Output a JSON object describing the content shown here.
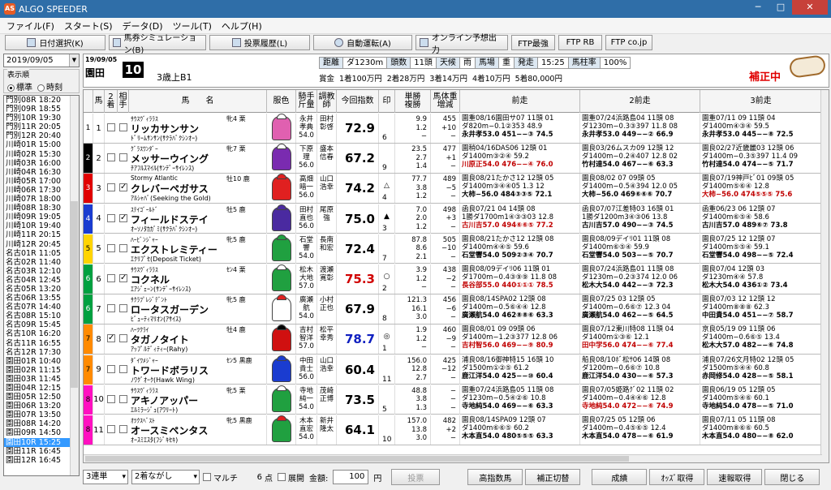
{
  "window": {
    "title": "ALGO SPEEDER",
    "icon_text": "AS"
  },
  "menu": [
    "ファイル(F)",
    "スタート(S)",
    "データ(D)",
    "ツール(T)",
    "ヘルプ(H)"
  ],
  "toolbar": [
    "日付選択(K)",
    "馬券シミュレーション(B)",
    "投票履歴(L)",
    "自動運転(A)",
    "オンライン予想出力",
    "FTP最強",
    "FTP RB",
    "FTP co.jp"
  ],
  "left": {
    "date": "2019/09/05",
    "sort_label": "表示順",
    "sort_opt1": "標準",
    "sort_opt2": "時刻",
    "races": [
      "門別08R 18:20",
      "門別09R 18:55",
      "門別10R 19:30",
      "門別11R 20:05",
      "門別12R 20:40",
      "川崎01R 15:00",
      "川崎02R 15:30",
      "川崎03R 16:00",
      "川崎04R 16:30",
      "川崎05R 17:00",
      "川崎06R 17:30",
      "川崎07R 18:00",
      "川崎08R 18:30",
      "川崎09R 19:05",
      "川崎10R 19:40",
      "川崎11R 20:15",
      "川崎12R 20:45",
      "名古01R 11:05",
      "名古02R 11:40",
      "名古03R 12:10",
      "名古04R 12:45",
      "名古05R 13:20",
      "名古06R 13:55",
      "名古07R 14:40",
      "名古08R 15:10",
      "名古09R 15:45",
      "名古10R 16:20",
      "名古11R 16:55",
      "名古12R 17:30",
      "園田01R 10:40",
      "園田02R 11:15",
      "園田03R 11:45",
      "園田04R 12:15",
      "園田05R 12:50",
      "園田06R 13:20",
      "園田07R 13:50",
      "園田08R 14:20",
      "園田09R 14:50",
      "園田10R 15:25",
      "園田11R 16:45",
      "園田12R 16:45"
    ],
    "selected_index": 38
  },
  "race": {
    "date": "19/09/05",
    "track": "園田",
    "number": "10",
    "class": "3歳上B1",
    "info": [
      {
        "k": "距離",
        "v": "ダ1230m"
      },
      {
        "k": "頭数",
        "v": "11頭"
      },
      {
        "k": "天候",
        "v": "雨"
      },
      {
        "k": "馬場",
        "v": "重"
      },
      {
        "k": "発走",
        "v": "15:25"
      },
      {
        "k": "馬柱率",
        "v": "100%"
      }
    ],
    "prize": "賞金 1着100万円 2着28万円 3着14万円 4着10万円 5着80,000円",
    "status": "補正中"
  },
  "columns": [
    "馬",
    "2着",
    "相手",
    "馬　　名",
    "服色",
    "騎手\n斤量",
    "調教\n師",
    "今回指数",
    "印",
    "単勝\n複勝",
    "馬体重\n増減",
    "前走",
    "2前走",
    "3前走"
  ],
  "horses": [
    {
      "waku": "1",
      "wakuColor": "#ffffff",
      "no": "1",
      "c2": false,
      "c3": false,
      "sire": "ｻｳｽｳﾞｨﾗﾗｽ",
      "sex": "牝4 栗",
      "name": "リッカサンサン",
      "dam": "ﾄﾞﾘｰﾑｻﾝｻﾝ(ｻｸﾗﾊﾞｸｼﾝｵｰ)",
      "silk": "#e060b0",
      "cap": "#ffffff",
      "jockey": "永井\n孝典\n54.0",
      "trainer": "田村\n彰啓",
      "index": "72.9",
      "idxColor": "",
      "mark": "",
      "pop": "6",
      "odds": "9.9\n1.2\n−",
      "weight": "455\n+10\n−",
      "p1": [
        "園重08/16園田サ07 11頭 01",
        "ダ820m−0.1②353 48.9",
        "永井孝53.0 451−−③ 74.5"
      ],
      "p1red": false,
      "p2": [
        "園重07/24浜路島04 11頭 08",
        "ダ1230m−0.3③397 11.8 08",
        "永井孝53.0 449−−② 66.9"
      ],
      "p2red": false,
      "p3": [
        "園重07/11 09 11頭 04",
        "ダ1400m④③④ 59.5",
        "永井孝53.0 445−−⑧ 72.5"
      ],
      "p3red": false
    },
    {
      "waku": "2",
      "wakuColor": "#000000",
      "no": "2",
      "c2": false,
      "c3": false,
      "sire": "ｸﾞﾗｽﾜﾝﾀﾞｰ",
      "sex": "牝7 栗",
      "name": "メッサーウイング",
      "dam": "ﾁｱﾌﾙｽﾏｲﾙ(ｻﾝﾃﾞｰｻｲﾚﾝｽ)",
      "silk": "#7a2bb0",
      "cap": "#ffffff",
      "jockey": "下原\n理\n56.0",
      "trainer": "盛本\n信春",
      "index": "67.2",
      "idxColor": "",
      "mark": "",
      "pop": "9",
      "odds": "23.5\n2.7\n1.4",
      "weight": "477\n+1\n−",
      "p1": [
        "園稍04/16DAS06 12頭 01",
        "ダ1400m③②④ 59.2",
        "川原正54.0 476−−④ 76.0"
      ],
      "p1red": true,
      "p2": [
        "園良03/26ムスカ09 12頭 12",
        "ダ1400m−0.2④407 12.8 02",
        "竹村達54.0 467−−⑥ 63.3"
      ],
      "p2red": false,
      "p3": [
        "園良02/27近畿麗03 12頭 06",
        "ダ1400m−0.3⑤397 11.4 09",
        "竹村達54.0 474−−⑤ 71.7"
      ],
      "p3red": false
    },
    {
      "waku": "3",
      "wakuColor": "#e00000",
      "no": "3",
      "c2": false,
      "c3": true,
      "sire": "Stormy Atlantic",
      "sex": "牡10 鹿",
      "name": "クレバーペガサス",
      "dam": "ｱﾙｼｬﾊﾞ(Seeking the Gold)",
      "silk": "#e02020",
      "cap": "#e02020",
      "jockey": "高畑\n暗一\n56.0",
      "trainer": "山口\n浩幸",
      "index": "74.2",
      "idxColor": "",
      "mark": "△",
      "pop": "4",
      "odds": "77.7\n3.8\n1.2",
      "weight": "489\n−5\n−",
      "p1": [
        "園良08/21たかさ12 12頭 05",
        "ダ1400m③④④05 1.3 12",
        "大柿−56.0 484③③⑤ 72.1"
      ],
      "p1red": false,
      "p2": [
        "園良08/02 07 09頭 05",
        "ダ1400m−0.5④394 12.0 05",
        "大柿−56.0 469⑥⑥⑥ 70.7"
      ],
      "p2red": false,
      "p3": [
        "園良07/19神戸ﾋﾞ01 09頭 05",
        "ダ1400m⑤⑥④ 12.8",
        "大柿−56.0 474⑤⑤⑤ 75.6"
      ],
      "p3red": true
    },
    {
      "waku": "4",
      "wakuColor": "#1a3cd0",
      "no": "4",
      "c2": false,
      "c3": true,
      "sire": "ｽﾃｲｺﾞｰﾙﾄﾞ",
      "sex": "牡5 鹿",
      "name": "フィールドステイ",
      "dam": "ｵｰｿﾉﾀｶｶﾞﾐ(ｻｸﾗﾊﾞｸｼﾝｵｰ)",
      "silk": "#4a2aa0",
      "cap": "#4a2aa0",
      "jockey": "田村\n直也\n56.0",
      "trainer": "尾原\n強",
      "index": "75.0",
      "idxColor": "",
      "mark": "▲",
      "pop": "3",
      "odds": "7.0\n2.0\n1.2",
      "weight": "498\n+3\n−",
      "p1": [
        "函良07/21 04 14頭 08",
        "1勝ダ1700m1④③③03 12.8",
        "古川吉57.0 494⑥⑥⑤ 77.2"
      ],
      "p1red": true,
      "p2": [
        "函良07/07江差特03 16頭 01",
        "1勝ダ1200m3④③06 13.8",
        "古川吉57.0 490−−③ 74.5"
      ],
      "p2red": false,
      "p3": [
        "函重06/23 06 12頭 07",
        "ダ1400m⑥⑤④ 58.6",
        "古川吉57.0 489⑥⑦ 73.8"
      ],
      "p3red": false
    },
    {
      "waku": "5",
      "wakuColor": "#ffd400",
      "no": "5",
      "c2": false,
      "c3": false,
      "sire": "ﾊｰﾋﾞﾝｼﾞｬｰ",
      "sex": "牝5 鹿",
      "name": "エクストレミティー",
      "dam": "ｴｸﾘﾌﾟｾ(Deposit Ticket)",
      "silk": "#20a040",
      "cap": "#20a040",
      "jockey": "石堂\n響\n54.0",
      "trainer": "長南\n和宏",
      "index": "72.4",
      "idxColor": "",
      "mark": "",
      "pop": "7",
      "odds": "87.8\n8.6\n2.1",
      "weight": "505\n−10\n−",
      "p1": [
        "園良08/21たかさ12 12頭 08",
        "ダ1400m④④⑤ 59.6",
        "石堂響54.0 509②③④ 70.7"
      ],
      "p1red": false,
      "p2": [
        "園良08/09デイﾘ01 11頭 08",
        "ダ1400m⑥⑤④ 59.9",
        "石堂響54.0 503−−⑤ 70.7"
      ],
      "p2red": false,
      "p3": [
        "園良07/25 12 12頭 07",
        "ダ1400m⑤⑤④ 59.1",
        "石堂響54.0 498−−⑤ 72.4"
      ],
      "p3red": false
    },
    {
      "waku": "6",
      "wakuColor": "#00a040",
      "no": "6",
      "c2": false,
      "c3": true,
      "sire": "ｻｳｽｳﾞｨﾗﾗｽ",
      "sex": "ｾﾝ4 栗",
      "name": "コクネル",
      "dam": "ｴｱｼﾞｪｰﾝ(ｻﾝﾃﾞｰｻｲﾚﾝｽ)",
      "silk": "#20a040",
      "cap": "#ffffff",
      "jockey": "松木\n大地\n57.0",
      "trainer": "渡瀬\n寛彰",
      "index": "75.3",
      "idxColor": "red",
      "mark": "○",
      "pop": "2",
      "odds": "3.9\n1.2\n−",
      "weight": "438\n−2\n−",
      "p1": [
        "園良08/09デイﾘ06 11頭 01",
        "ダ1700m−0.4③⑨⑨ 11.8 08",
        "長谷部55.0 440①①① 78.5"
      ],
      "p1red": true,
      "p2": [
        "園良07/24浜路島01 11頭 08",
        "ダ1230m−0.2③374 12.0 06",
        "松木大54.0 442−−③ 72.3"
      ],
      "p2red": false,
      "p3": [
        "園良07/04 12頭 03",
        "ダ1230m④④ 57.8",
        "松木大54.0 436①② 73.4"
      ],
      "p3red": false
    },
    {
      "waku": "6",
      "wakuColor": "#00a040",
      "no": "7",
      "c2": false,
      "c3": false,
      "sire": "ｻｸﾗﾌﾟﾚｼﾞﾃﾞﾝﾄ",
      "sex": "牝5 鹿",
      "name": "ロータスガーデン",
      "dam": "ﾋﾞｭｰﾃｨﾏﾘｵﾝ(ｱｻｲｽ)",
      "silk": "#ffffff",
      "cap": "#e02020",
      "jockey": "廣瀬\n航\n54.0",
      "trainer": "小村\n正也",
      "index": "67.9",
      "idxColor": "",
      "mark": "",
      "pop": "8",
      "odds": "121.3\n16.1\n3.0",
      "weight": "456\n−6\n−",
      "p1": [
        "園良08/14SPA02 12頭 08",
        "ダ1400m−0.5⑥④④ 12.8",
        "廣瀬航54.0 462⑧⑧⑥ 63.3"
      ],
      "p1red": false,
      "p2": [
        "園良07/25 03 12頭 05",
        "ダ1400m−0.6⑥⑦ 12.3 04",
        "廣瀬航54.0 462−−⑤ 64.5"
      ],
      "p2red": false,
      "p3": [
        "園良07/03 12 12頭 12",
        "ダ1400m⑧⑧⑧ 62.3",
        "中田貴54.0 451−−⑦ 58.7"
      ],
      "p3red": false
    },
    {
      "waku": "7",
      "wakuColor": "#ff8a00",
      "no": "8",
      "c2": true,
      "c3": false,
      "sire": "ﾊｰﾂｸﾗｲ",
      "sex": "牡4 鹿",
      "name": "タガノタイト",
      "dam": "ｱｯﾌﾟﾙﾃﾞｨﾃｨｰ(Rahy)",
      "silk": "#d01010",
      "cap": "#000000",
      "jockey": "吉村\n智洋\n57.0",
      "trainer": "松平\n幸秀",
      "index": "78.7",
      "idxColor": "blue",
      "mark": "◎",
      "pop": "1",
      "odds": "1.9\n1.2\n−",
      "weight": "460\n−9\n−",
      "p1": [
        "園良08/01 09 09頭 06",
        "ダ1400m−1.2③377 12.8 06",
        "吉村智56.0 469−−⑨ 80.9"
      ],
      "p1red": true,
      "p2": [
        "園良07/12東川特08 11頭 04",
        "ダ1400m①③⑥ 12.1",
        "田中学56.0 474−−⑥ 77.4"
      ],
      "p2red": true,
      "p3": [
        "京良05/19 09 11頭 06",
        "ダ1400m−0.6⑥⑤ 13.4",
        "松木大57.0 482−−⑥ 74.8"
      ],
      "p3red": false
    },
    {
      "waku": "7",
      "wakuColor": "#ff8a00",
      "no": "9",
      "c2": false,
      "c3": false,
      "sire": "ﾀﾞｲﾜﾒｼﾞｬｰ",
      "sex": "ｾﾝ5 黒鹿",
      "name": "トワードボラリス",
      "dam": "ﾉﾜｸﾞｵｰｸ(Hawk Wing)",
      "silk": "#1a3cd0",
      "cap": "#1a3cd0",
      "jockey": "中田\n貴士\n56.0",
      "trainer": "山口\n浩幸",
      "index": "60.4",
      "idxColor": "",
      "mark": "",
      "pop": "11",
      "odds": "156.0\n12.8\n2.7",
      "weight": "425\n−12\n−",
      "p1": [
        "浦良08/16御神特15 16頭 10",
        "ダ1500m①②⑤ 61.2",
        "鹿江洋54.0 425−−⑩ 60.4"
      ],
      "p1red": false,
      "p2": [
        "船良08/10ﾎﾞ松ｻ06 14頭 08",
        "ダ1200m−0.6⑥⑦ 10.8",
        "鹿江洋54.0 430−−⑥ 57.3"
      ],
      "p2red": false,
      "p3": [
        "浦良07/26文月特02 12頭 05",
        "ダ1500m⑤④④ 60.8",
        "赤岡修54.0 428−−⑤ 58.1"
      ],
      "p3red": false
    },
    {
      "waku": "8",
      "wakuColor": "#ff10c0",
      "no": "10",
      "c2": false,
      "c3": false,
      "sire": "ｻｳｽｳﾞｨﾗﾗｽ",
      "sex": "牝5 栗",
      "name": "アキノアッパー",
      "dam": "ｴﾙﾐﾗｰｼﾞｭ(ｱﾜﾘｰﾄ)",
      "silk": "#20a040",
      "cap": "#ffffff",
      "jockey": "寺地\n純一\n54.0",
      "trainer": "茂崎\n正博",
      "index": "73.5",
      "idxColor": "",
      "mark": "",
      "pop": "5",
      "odds": "48.8\n3.8\n1.3",
      "weight": "−\n−\n−",
      "p1": [
        "園重07/24浜路島05 11頭 08",
        "ダ1230m−0.5④②⑥ 10.8",
        "寺地純54.0 469−−⑥ 63.3"
      ],
      "p1red": false,
      "p2": [
        "園良07/05姫路ｸﾞ02 11頭 02",
        "ダ1400m−0.4④④⑥ 12.8",
        "寺地純54.0 472−−⑥ 74.9"
      ],
      "p2red": true,
      "p3": [
        "園良06/19 05 12頭 05",
        "ダ1400m⑤④⑥ 60.1",
        "寺地純54.0 478−−⑤ 71.0"
      ],
      "p3red": false
    },
    {
      "waku": "8",
      "wakuColor": "#ff10c0",
      "no": "11",
      "c2": false,
      "c3": false,
      "sire": "ｵﾂｸｽﾍﾞｽﾄ",
      "sex": "牝5 黒鹿",
      "name": "オースミペンタス",
      "dam": "ｵｰｽﾐｴｽﾀ(ﾌｼﾞｷｾｷ)",
      "silk": "#20a040",
      "cap": "#e02020",
      "jockey": "木本\n直宏\n54.0",
      "trainer": "新井\n隆太",
      "index": "64.1",
      "idxColor": "",
      "mark": "",
      "pop": "10",
      "odds": "157.0\n13.8\n3.0",
      "weight": "482\n+2\n−",
      "p1": [
        "園良08/14SPA09 12頭 07",
        "ダ1400m⑥⑥⑤ 60.2",
        "木本直54.0 480⑤⑤⑤ 63.3"
      ],
      "p1red": false,
      "p2": [
        "園良07/25 05 12頭 06",
        "ダ1400m−0.4⑤⑥⑤ 12.4",
        "木本直54.0 478−−⑥ 61.9"
      ],
      "p2red": false,
      "p3": [
        "園良07/11 05 11頭 08",
        "ダ1400m⑧⑥⑥ 60.5",
        "木本直54.0 480−−⑧ 62.0"
      ],
      "p3red": false
    }
  ],
  "bottom": {
    "bet_type": "3連単",
    "mode": "2着ながし",
    "multi": "マルチ",
    "points": "6",
    "points_unit": "点",
    "expand": "展開",
    "amount_label": "金額:",
    "amount": "100",
    "yen": "円",
    "buttons": [
      "投票",
      "高指数馬",
      "補正切替",
      "成績",
      "ｵｯｽﾞ取得",
      "速報取得",
      "閉じる"
    ]
  }
}
